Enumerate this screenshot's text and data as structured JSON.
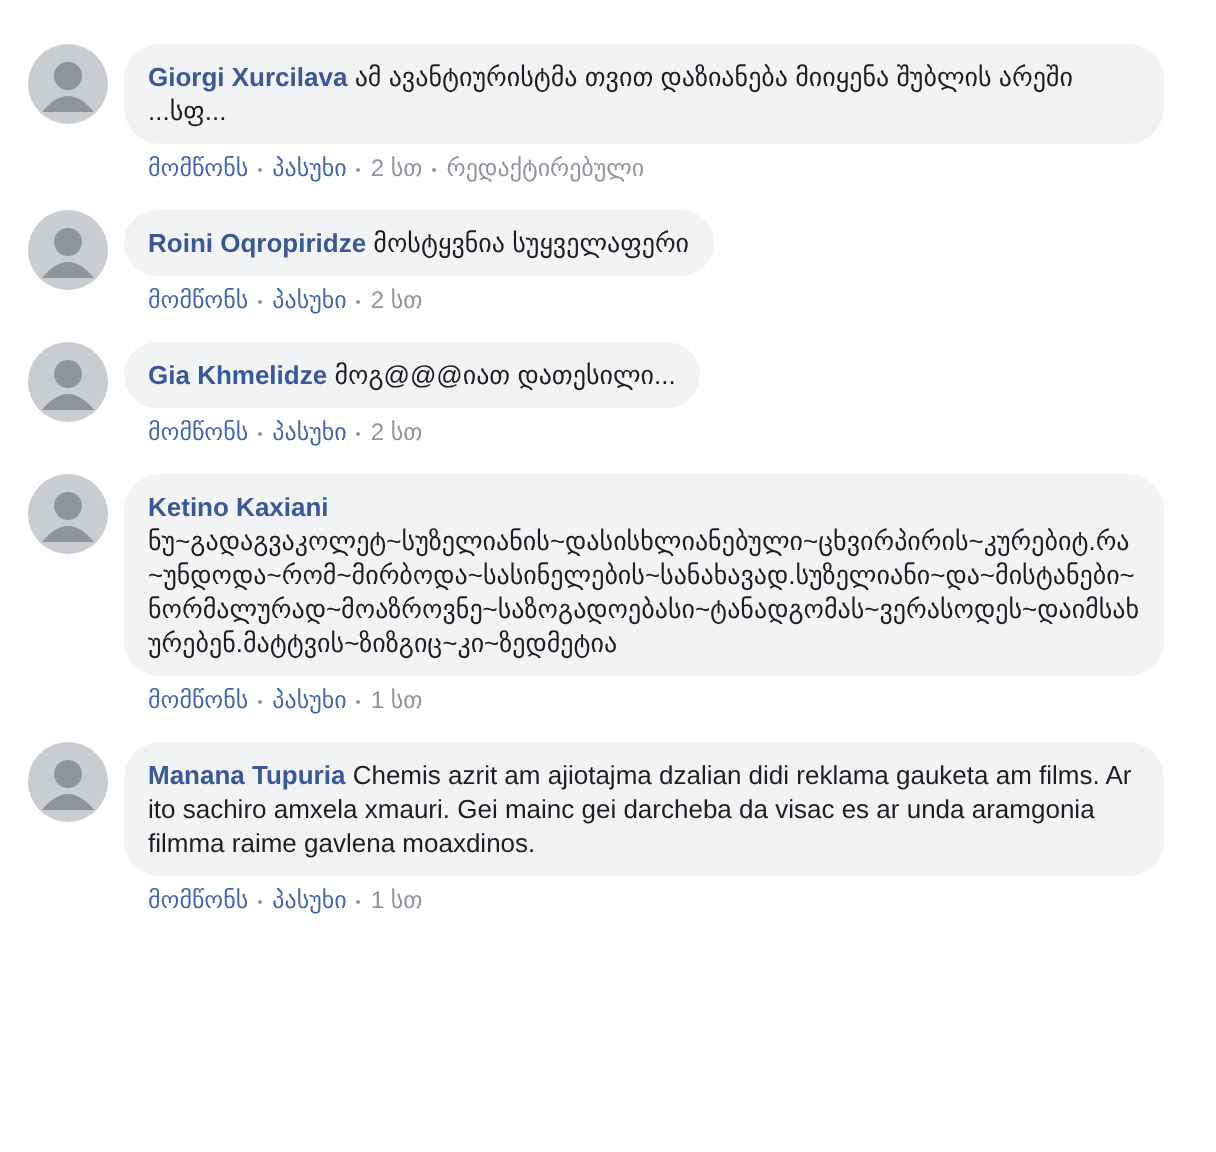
{
  "comments": [
    {
      "author": "Giorgi Xurcilava",
      "text": "ამ ავანტიურისტმა თვით დაზიანება მიიყენა შუბლის არეში ...სფ...",
      "like": "მომწონს",
      "reply": "პასუხი",
      "time": "2 სთ",
      "edited": "რედაქტირებული"
    },
    {
      "author": "Roini Oqropiridze",
      "text": "მოსტყვნია სუყველაფერი",
      "like": "მომწონს",
      "reply": "პასუხი",
      "time": "2 სთ"
    },
    {
      "author": "Gia Khmelidze",
      "text": "მოგ@@@იათ დათესილი...",
      "like": "მომწონს",
      "reply": "პასუხი",
      "time": "2 სთ"
    },
    {
      "author": "Ketino Kaxiani",
      "text": "ნუ~გადაგვაკოლეტ~სუზელიანის~დასისხლიანებული~ცხვირპირის~კურებიტ.რა~უნდოდა~რომ~მირბოდა~სასინელების~სანახავად.სუზელიანი~და~მისტანები~ნორმალურად~მოაზროვნე~საზოგადოებასი~ტანადგომას~ვერასოდეს~დაიმსახურებენ.მატტვის~ზიზგიც~კი~ზედმეტია",
      "like": "მომწონს",
      "reply": "პასუხი",
      "time": "1 სთ"
    },
    {
      "author": "Manana Tupuria",
      "text": "Chemis azrit am ajiotajma dzalian didi reklama gauketa am films. Ar ito sachiro amxela xmauri. Gei mainc gei darcheba da visac es ar unda aramgonia filmma raime gavlena moaxdinos.",
      "like": "მომწონს",
      "reply": "პასუხი",
      "time": "1 სთ"
    }
  ]
}
